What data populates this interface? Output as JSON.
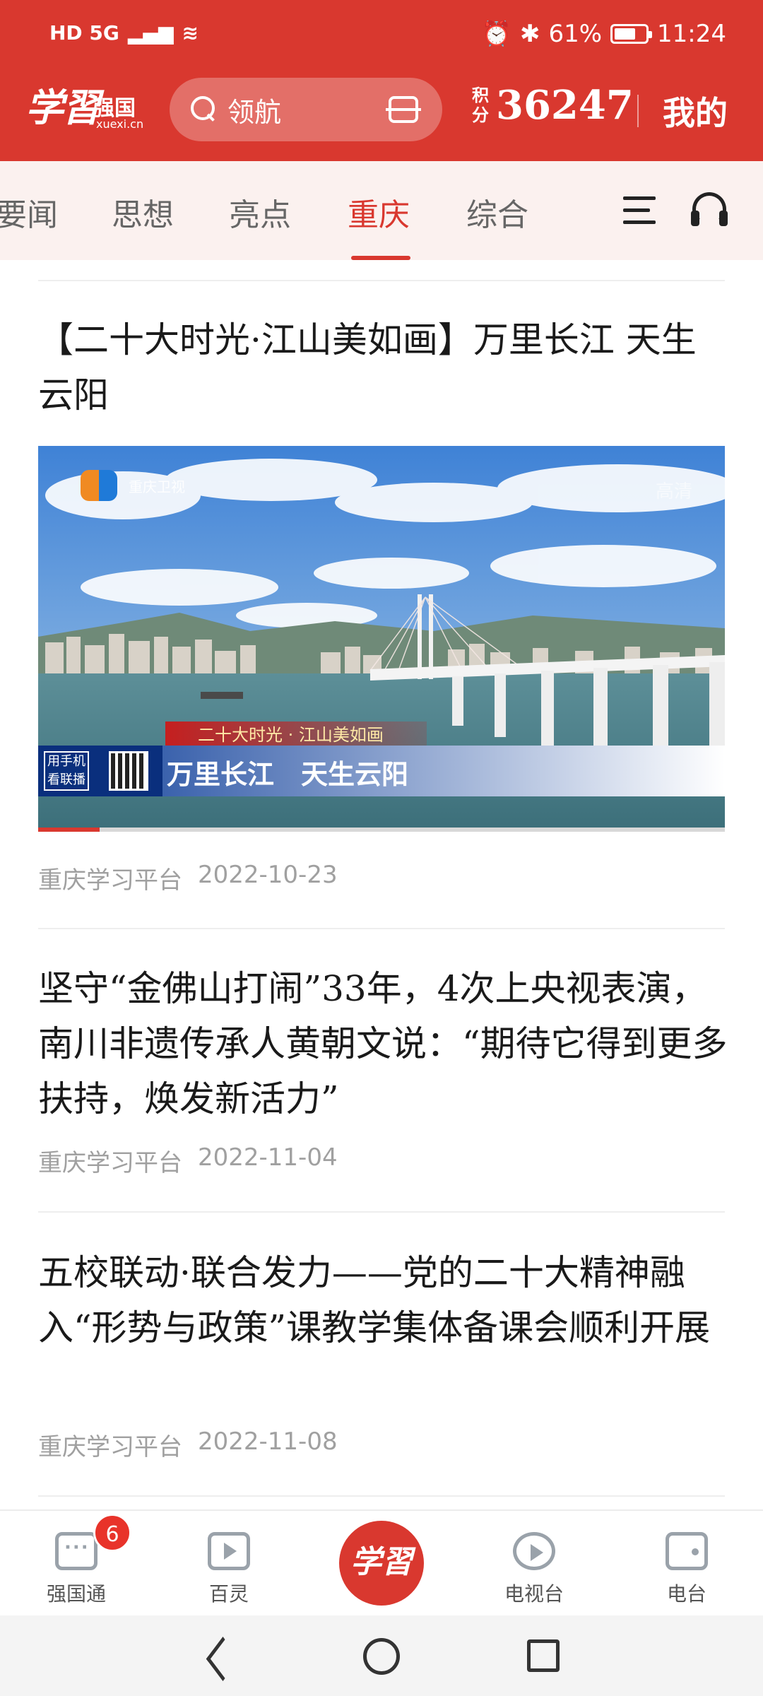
{
  "status_bar": {
    "network": "HD 5G",
    "battery": "61%",
    "battery_level": 0.61,
    "time": "11:24"
  },
  "header": {
    "logo_mark": "学習",
    "logo_name": "强国",
    "logo_url": "xuexi.cn",
    "search_placeholder": "领航",
    "points_label": "积分",
    "points_value": "36247",
    "mine_label": "我的"
  },
  "tabs": {
    "items": [
      {
        "label": "要闻"
      },
      {
        "label": "思想"
      },
      {
        "label": "亮点"
      },
      {
        "label": "重庆"
      },
      {
        "label": "综合"
      }
    ],
    "active_index": 3
  },
  "articles": [
    {
      "title": "【二十大时光·江山美如画】万里长江 天生云阳",
      "source": "重庆学习平台",
      "date": "2022-10-23",
      "video": {
        "channel": "重庆卫视",
        "hd_badge": "高清",
        "tag": "二十大时光 · 江山美如画",
        "headline": "万里长江　天生云阳",
        "qr_text": "用手机看联播",
        "progress": 0.09
      }
    },
    {
      "title": "坚守“金佛山打闹”33年，4次上央视表演，南川非遗传承人黄朝文说：“期待它得到更多扶持，焕发新活力”",
      "source": "重庆学习平台",
      "date": "2022-11-04"
    },
    {
      "title": "五校联动·联合发力——党的二十大精神融入“形势与政策”课教学集体备课会顺利开展",
      "source": "重庆学习平台",
      "date": "2022-11-08"
    }
  ],
  "bottom_nav": {
    "items": [
      {
        "label": "强国通",
        "icon": "chat-icon",
        "badge": "6"
      },
      {
        "label": "百灵",
        "icon": "video-icon"
      },
      {
        "label": "学習",
        "icon": "center-logo"
      },
      {
        "label": "电视台",
        "icon": "tv-play-icon"
      },
      {
        "label": "电台",
        "icon": "radio-icon"
      }
    ]
  },
  "colors": {
    "brand_red": "#d9382f",
    "meta_gray": "#a0a0a0",
    "tab_inactive": "#666666"
  }
}
